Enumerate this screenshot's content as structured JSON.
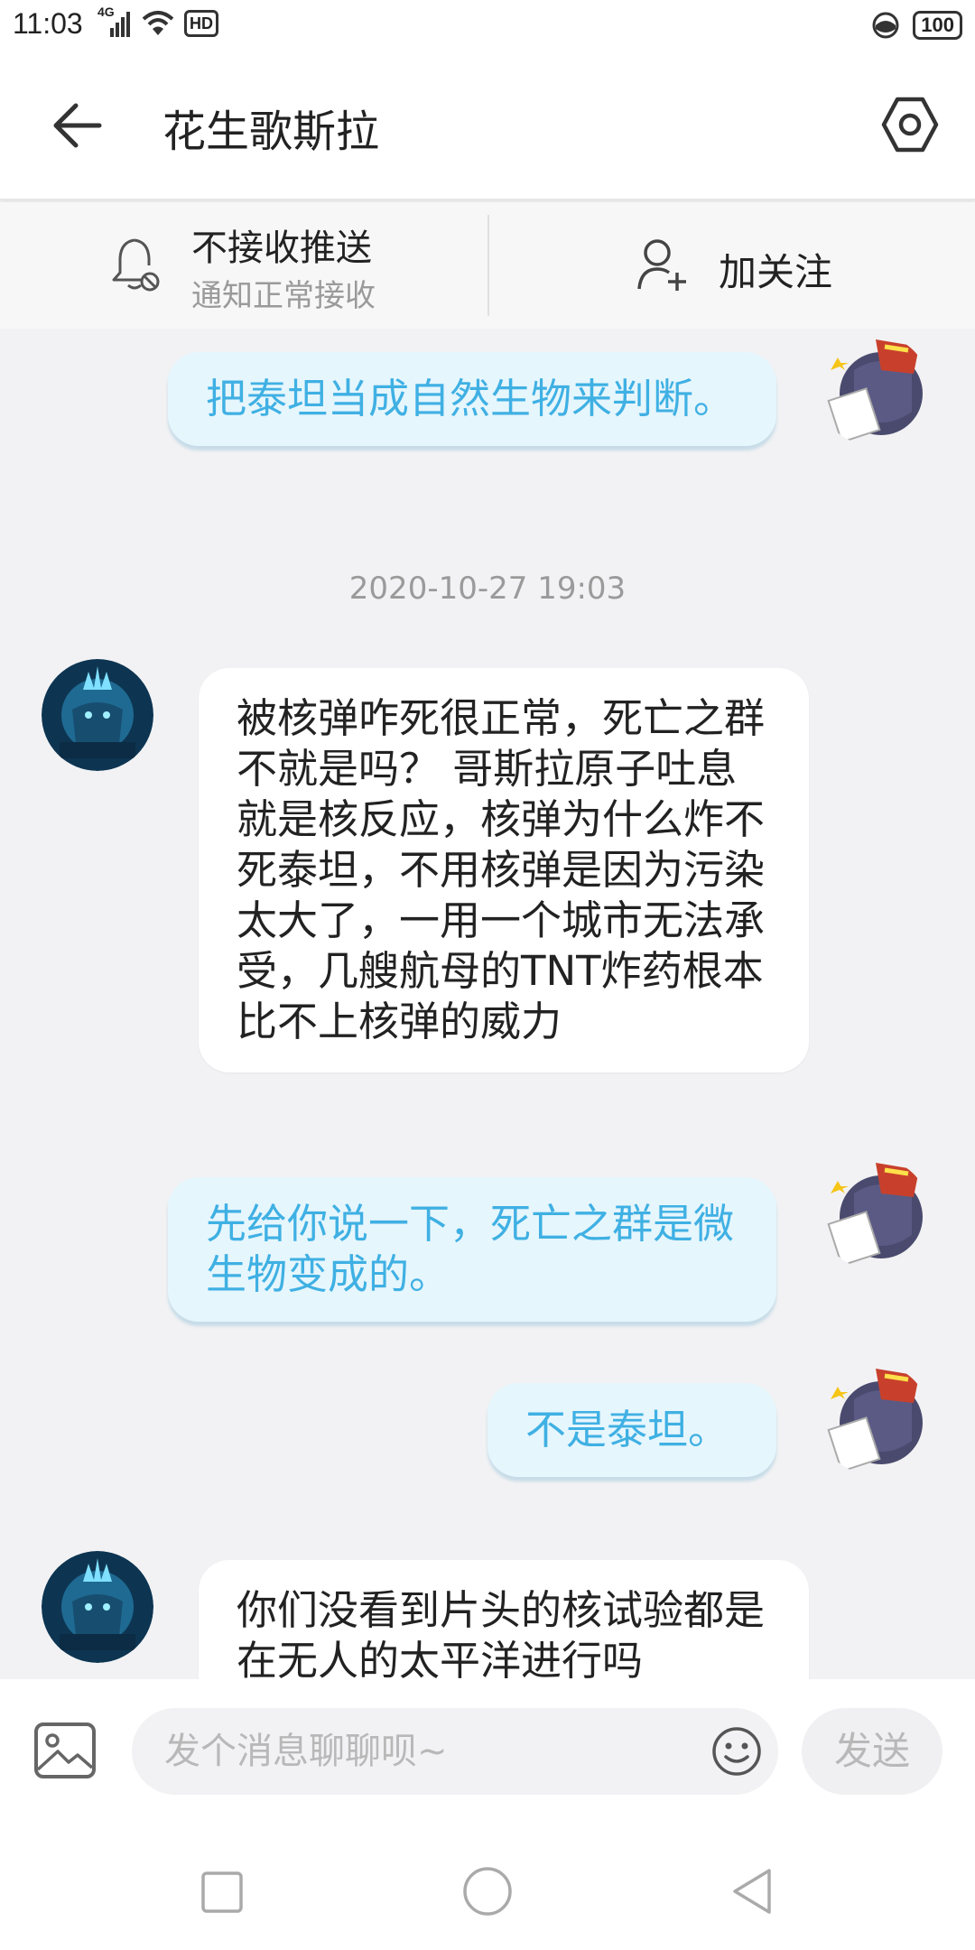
{
  "status_bar": {
    "time": "11:03",
    "network": "4G",
    "hd": "HD",
    "battery": "100"
  },
  "header": {
    "title": "花生歌斯拉"
  },
  "notification_bar": {
    "push_title": "不接收推送",
    "push_subtitle": "通知正常接收",
    "follow_label": "加关注"
  },
  "messages": [
    {
      "sender": "me",
      "text": "把泰坦当成自然生物来判断。"
    },
    {
      "type": "timestamp",
      "text": "2020-10-27 19:03"
    },
    {
      "sender": "them",
      "text": "被核弹咋死很正常，死亡之群不就是吗？ 哥斯拉原子吐息就是核反应，核弹为什么炸不死泰坦，不用核弹是因为污染太大了，一用一个城市无法承受，几艘航母的TNT炸药根本比不上核弹的威力"
    },
    {
      "sender": "me",
      "text": "先给你说一下，死亡之群是微生物变成的。"
    },
    {
      "sender": "me",
      "text": "不是泰坦。"
    },
    {
      "sender": "them",
      "text": "你们没看到片头的核试验都是在无人的太平洋进行吗"
    }
  ],
  "input_bar": {
    "placeholder": "发个消息聊聊呗~",
    "send_label": "发送"
  },
  "colors": {
    "my_bubble_bg": "#e6f6fd",
    "my_bubble_text": "#3fb0e3",
    "their_bubble_bg": "#ffffff",
    "chat_bg": "#f2f2f4"
  }
}
